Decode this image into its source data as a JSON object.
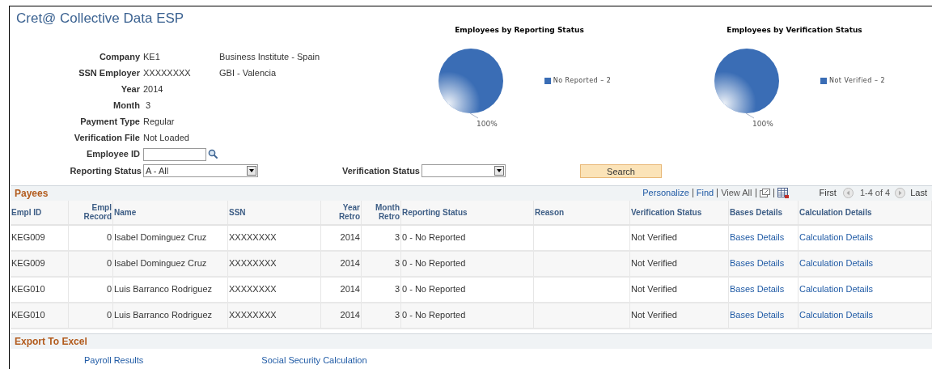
{
  "page": {
    "title": "Cret@ Collective Data ESP"
  },
  "fields": [
    {
      "kind": "text",
      "label": "Company",
      "value": "KE1",
      "description": "Business Institute - Spain"
    },
    {
      "kind": "text",
      "label": "SSN Employer",
      "value": "XXXXXXXX",
      "description": "GBI - Valencia"
    },
    {
      "kind": "text",
      "label": "Year",
      "value": "2014"
    },
    {
      "kind": "text",
      "label": "Month",
      "value": " 3"
    },
    {
      "kind": "text",
      "label": "Payment Type",
      "value": "Regular"
    },
    {
      "kind": "text",
      "label": "Verification File",
      "value": "Not Loaded"
    },
    {
      "kind": "lookup",
      "label": "Employee ID"
    }
  ],
  "charts": [
    {
      "title": "Employees by Reporting Status",
      "legend": [
        {
          "label": "No Reported – 2",
          "color": "#3a6db5"
        }
      ],
      "slice_label": "100%"
    },
    {
      "title": "Employees by Verification Status",
      "legend": [
        {
          "label": "Not Verified – 2",
          "color": "#3a6db5"
        }
      ],
      "slice_label": "100%"
    }
  ],
  "filters": {
    "reporting_status": {
      "label": "Reporting Status",
      "value": "A - All"
    },
    "verification_status": {
      "label": "Verification Status"
    },
    "search_button": "Search"
  },
  "payees": {
    "title": "Payees",
    "links": [
      "Personalize",
      "Find",
      "View All"
    ],
    "first": "First",
    "range": "1-4 of 4",
    "last": "Last",
    "columns": [
      {
        "label": "Empl ID",
        "kind": "text"
      },
      {
        "label": "Empl Record",
        "kind": "number"
      },
      {
        "label": "Name",
        "kind": "text"
      },
      {
        "label": "SSN",
        "kind": "text"
      },
      {
        "label": "Year Retro",
        "kind": "number"
      },
      {
        "label": "Month Retro",
        "kind": "number"
      },
      {
        "label": "Reporting Status",
        "kind": "text"
      },
      {
        "label": "Reason",
        "kind": "text"
      },
      {
        "label": "Verification Status",
        "kind": "text"
      },
      {
        "label": "Bases Details",
        "kind": "link"
      },
      {
        "label": "Calculation Details",
        "kind": "link"
      }
    ],
    "rows": [
      [
        "KEG009",
        "0",
        "Isabel Dominguez Cruz",
        "XXXXXXXX",
        "2014",
        "3",
        "0 - No Reported",
        null,
        "Not Verified",
        "Bases Details",
        "Calculation Details"
      ],
      [
        "KEG009",
        "0",
        "Isabel Dominguez Cruz",
        "XXXXXXXX",
        "2014",
        "3",
        "0 - No Reported",
        null,
        "Not Verified",
        "Bases Details",
        "Calculation Details"
      ],
      [
        "KEG010",
        "0",
        "Luis Barranco Rodriguez",
        "XXXXXXXX",
        "2014",
        "3",
        "0 - No Reported",
        null,
        "Not Verified",
        "Bases Details",
        "Calculation Details"
      ],
      [
        "KEG010",
        "0",
        "Luis Barranco Rodriguez",
        "XXXXXXXX",
        "2014",
        "3",
        "0 - No Reported",
        null,
        "Not Verified",
        "Bases Details",
        "Calculation Details"
      ]
    ]
  },
  "export": {
    "title": "Export To Excel",
    "links": [
      "Payroll Results",
      "Social Security Calculation"
    ]
  }
}
